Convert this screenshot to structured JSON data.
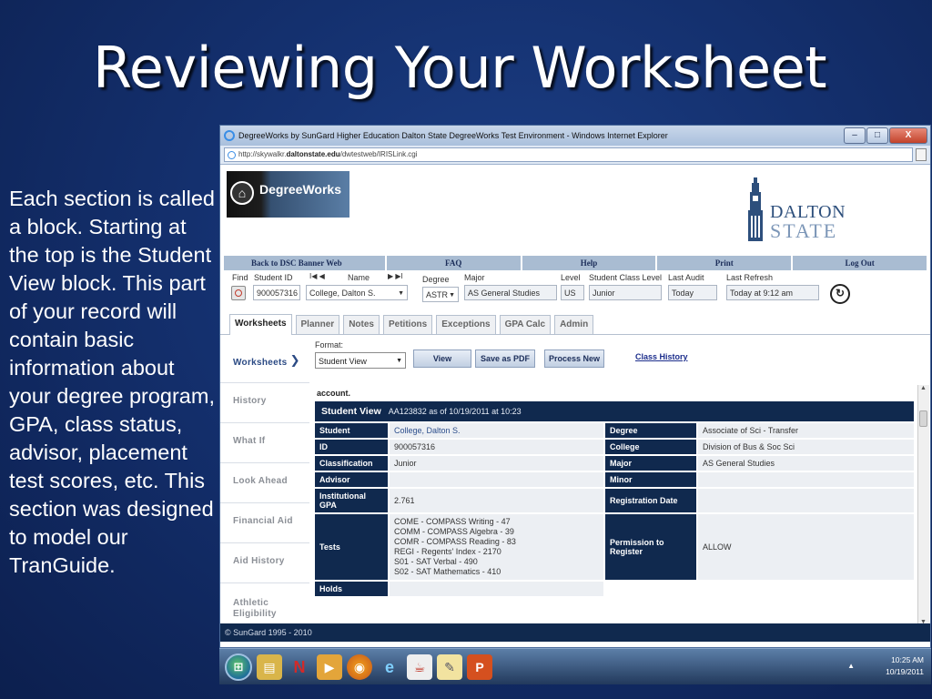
{
  "slide": {
    "title": "Reviewing Your Worksheet",
    "body": "Each section is called a block. Starting at the top is the Student View block.  This part of your record will contain basic information about your degree program, GPA, class status, advisor, placement test scores, etc.  This section was designed to model our TranGuide."
  },
  "browser": {
    "window_title": "DegreeWorks by SunGard Higher Education Dalton State DegreeWorks Test Environment - Windows Internet Explorer",
    "url_prefix": "http://skywalkr.",
    "url_domain": "daltonstate.edu",
    "url_path": "/dwtestweb/IRISLink.cgi",
    "controls": {
      "minimize": "–",
      "maximize": "□",
      "close": "X"
    }
  },
  "header": {
    "logo_text": "DegreeWorks",
    "school_line1": "DALTON",
    "school_line2": "STATE"
  },
  "nav": [
    "Back to DSC Banner Web",
    "FAQ",
    "Help",
    "Print",
    "Log Out"
  ],
  "student_bar": {
    "find_label": "Find",
    "student_id_label": "Student ID",
    "student_id": "900057316",
    "name_label": "Name",
    "name": "College, Dalton S.",
    "degree_label": "Degree",
    "degree": "ASTR",
    "major_label": "Major",
    "major": "AS General Studies",
    "level_label": "Level",
    "level": "US",
    "class_level_label": "Student Class Level",
    "class_level": "Junior",
    "last_audit_label": "Last Audit",
    "last_audit": "Today",
    "last_refresh_label": "Last Refresh",
    "last_refresh": "Today at 9:12 am",
    "nav_first": "I◀  ◀",
    "nav_last": "▶  ▶I"
  },
  "tabs": [
    "Worksheets",
    "Planner",
    "Notes",
    "Petitions",
    "Exceptions",
    "GPA Calc",
    "Admin"
  ],
  "sidebar": [
    "Worksheets",
    "History",
    "What If",
    "Look Ahead",
    "Financial Aid",
    "Aid History",
    "Athletic Eligibility"
  ],
  "format_bar": {
    "format_label": "Format:",
    "format_value": "Student View",
    "view_btn": "View",
    "pdf_btn": "Save as PDF",
    "process_btn": "Process New",
    "class_history": "Class History"
  },
  "main": {
    "account_text": "account.",
    "block_title": "Student View",
    "block_subtitle": "AA123832 as of 10/19/2011 at 10:23",
    "rows": {
      "student_label": "Student",
      "student": "College, Dalton S.",
      "degree_label": "Degree",
      "degree": "Associate of Sci - Transfer",
      "id_label": "ID",
      "id": "900057316",
      "college_label": "College",
      "college": "Division of Bus & Soc Sci",
      "classification_label": "Classification",
      "classification": "Junior",
      "major_label": "Major",
      "major": "AS General Studies",
      "advisor_label": "Advisor",
      "advisor": "",
      "minor_label": "Minor",
      "minor": "",
      "gpa_label": "Institutional GPA",
      "gpa": "2.761",
      "regdate_label": "Registration Date",
      "regdate": "",
      "tests_label": "Tests",
      "tests": [
        "COME - COMPASS Writing - 47",
        "COMM - COMPASS Algebra - 39",
        "COMR - COMPASS Reading - 83",
        "REGI - Regents' Index - 2170",
        "S01 - SAT Verbal - 490",
        "S02 - SAT Mathematics - 410"
      ],
      "permission_label": "Permission to Register",
      "permission": "ALLOW",
      "holds_label": "Holds"
    }
  },
  "footer": "© SunGard 1995 - 2010",
  "taskbar": {
    "time": "10:25 AM",
    "date": "10/19/2011"
  }
}
